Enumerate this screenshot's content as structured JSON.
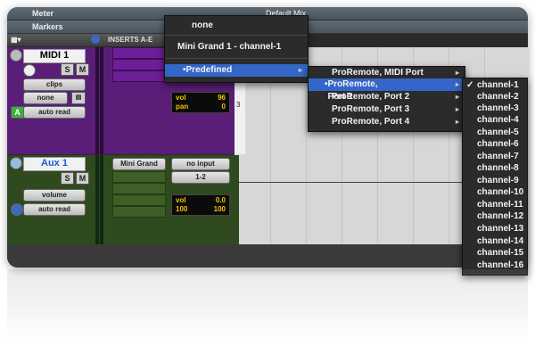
{
  "rulers": {
    "meter": "Meter",
    "markers": "Markers",
    "title": "Default Mix"
  },
  "header": {
    "inserts": "INSERTS A-E"
  },
  "midi_track": {
    "name": "MIDI 1",
    "solo": "S",
    "mute": "M",
    "clips": "clips",
    "none": "none",
    "automation": "auto read",
    "vol_label": "vol",
    "vol_value": "96",
    "pan_label": "pan",
    "pan_value": "0",
    "ruler_mark": "3"
  },
  "aux_track": {
    "name": "Aux 1",
    "solo": "S",
    "mute": "M",
    "view": "volume",
    "automation": "auto read",
    "insert": "Mini Grand",
    "input": "no input",
    "output": "1-2",
    "vol_label": "vol",
    "vol_value": "0.0",
    "pan_left": "100",
    "pan_right": "100"
  },
  "menu1": {
    "items": [
      "none",
      "Mini Grand 1 - channel-1"
    ],
    "predefined": "Predefined"
  },
  "menu2": {
    "items": [
      "ProRemote, MIDI Port",
      "ProRemote, Port 1",
      "ProRemote, Port 2",
      "ProRemote, Port 3",
      "ProRemote, Port 4"
    ]
  },
  "menu3": {
    "items": [
      "channel-1",
      "channel-2",
      "channel-3",
      "channel-4",
      "channel-5",
      "channel-6",
      "channel-7",
      "channel-8",
      "channel-9",
      "channel-10",
      "channel-11",
      "channel-12",
      "channel-13",
      "channel-14",
      "channel-15",
      "channel-16"
    ]
  },
  "colors": {
    "midi": "#5a1e78",
    "aux": "#2f4a1e",
    "highlight": "#3466c9",
    "lcd": "#f3c500"
  }
}
